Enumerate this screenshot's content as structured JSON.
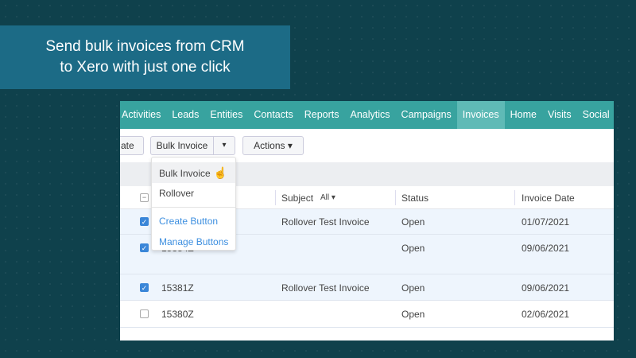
{
  "banner": {
    "line1": "Send bulk invoices from CRM",
    "line2": "to Xero with just one click"
  },
  "nav": {
    "items": [
      "Activities",
      "Leads",
      "Entities",
      "Contacts",
      "Reports",
      "Analytics",
      "Campaigns",
      "Invoices",
      "Home",
      "Visits",
      "Social"
    ],
    "active": "Invoices"
  },
  "toolbar": {
    "prev_button_partial": "ate",
    "bulk_invoice": "Bulk Invoice",
    "caret": "▾",
    "actions": "Actions ▾"
  },
  "dropdown": {
    "items": [
      "Bulk Invoice",
      "Rollover"
    ],
    "links": [
      "Create Button",
      "Manage Buttons"
    ]
  },
  "table": {
    "headers": {
      "subject": "Subject",
      "subject_filter": "All ▾",
      "status": "Status",
      "invoice_date": "Invoice Date"
    },
    "rows": [
      {
        "id": "",
        "subject": "Rollover Test Invoice",
        "status": "Open",
        "date": "01/07/2021",
        "checked": true
      },
      {
        "id": "15384Z",
        "subject": "",
        "status": "Open",
        "date": "09/06/2021",
        "checked": true
      },
      {
        "id": "15381Z",
        "subject": "Rollover Test Invoice",
        "status": "Open",
        "date": "09/06/2021",
        "checked": true
      },
      {
        "id": "15380Z",
        "subject": "",
        "status": "Open",
        "date": "02/06/2021",
        "checked": false
      }
    ]
  }
}
